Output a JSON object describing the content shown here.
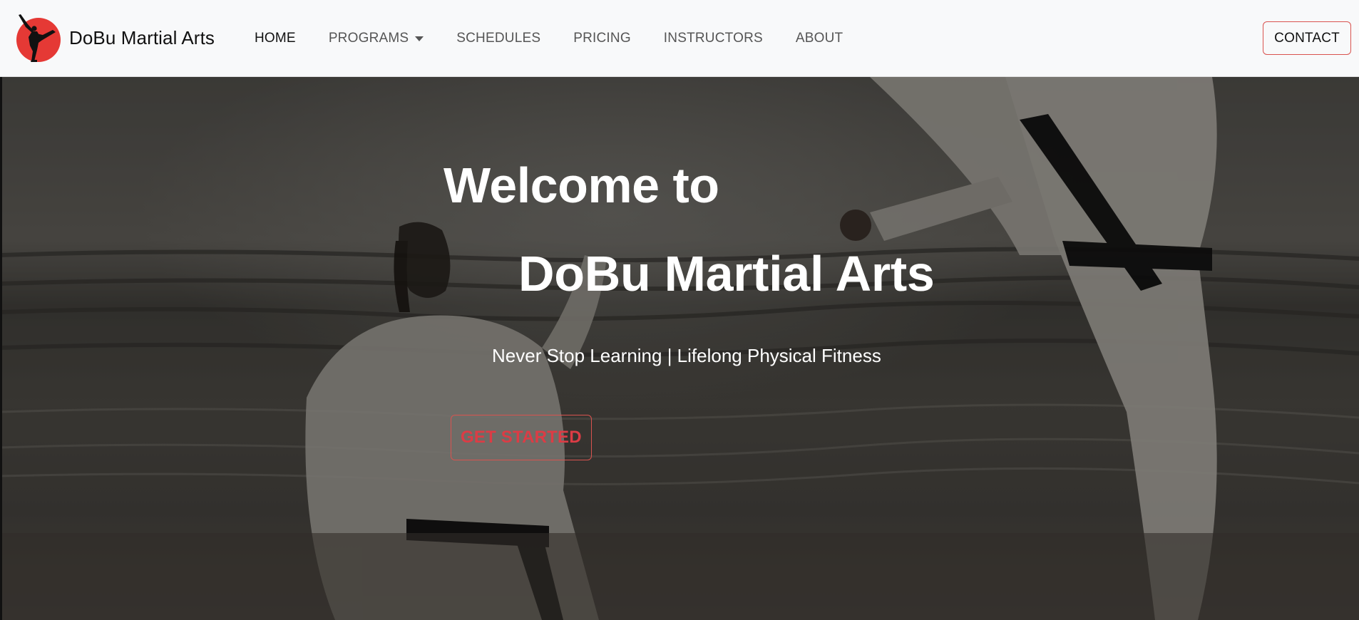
{
  "brand": {
    "name": "DoBu Martial Arts",
    "logo_icon": "karate-kick-silhouette-icon",
    "logo_color": "#e53935"
  },
  "nav": {
    "items": [
      {
        "label": "HOME",
        "active": true
      },
      {
        "label": "PROGRAMS",
        "dropdown": true
      },
      {
        "label": "SCHEDULES"
      },
      {
        "label": "PRICING"
      },
      {
        "label": "INSTRUCTORS"
      },
      {
        "label": "ABOUT"
      }
    ],
    "contact_label": "CONTACT"
  },
  "hero": {
    "title_line1": "Welcome to",
    "title_line2": "DoBu Martial Arts",
    "subtitle": "Never Stop Learning | Lifelong Physical Fitness",
    "cta_label": "GET STARTED",
    "background": "karate-practitioners-on-beach-photo"
  },
  "colors": {
    "accent": "#dc3c45",
    "navbar_bg": "#f8f9fa"
  }
}
